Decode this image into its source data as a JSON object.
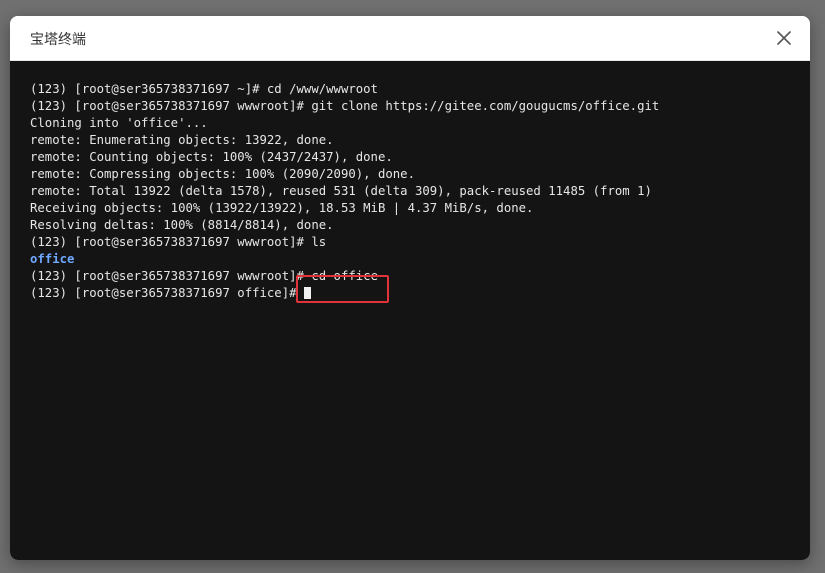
{
  "dialog": {
    "title": "宝塔终端",
    "close_icon": "close-icon"
  },
  "terminal": {
    "lines": [
      "(123) [root@ser365738371697 ~]# cd /www/wwwroot",
      "(123) [root@ser365738371697 wwwroot]# git clone https://gitee.com/gougucms/office.git",
      "Cloning into 'office'...",
      "remote: Enumerating objects: 13922, done.",
      "remote: Counting objects: 100% (2437/2437), done.",
      "remote: Compressing objects: 100% (2090/2090), done.",
      "remote: Total 13922 (delta 1578), reused 531 (delta 309), pack-reused 11485 (from 1)",
      "Receiving objects: 100% (13922/13922), 18.53 MiB | 4.37 MiB/s, done.",
      "Resolving deltas: 100% (8814/8814), done.",
      "(123) [root@ser365738371697 wwwroot]# ls"
    ],
    "ls_output": "office",
    "cd_prompt": "(123) [root@ser365738371697 wwwroot]#",
    "cd_command": " cd office",
    "current_prompt": "(123) [root@ser365738371697 office]# ",
    "colors": {
      "background": "#141414",
      "text": "#e6e6e6",
      "directory": "#6fa8ff",
      "highlight": "#e0343a"
    }
  }
}
